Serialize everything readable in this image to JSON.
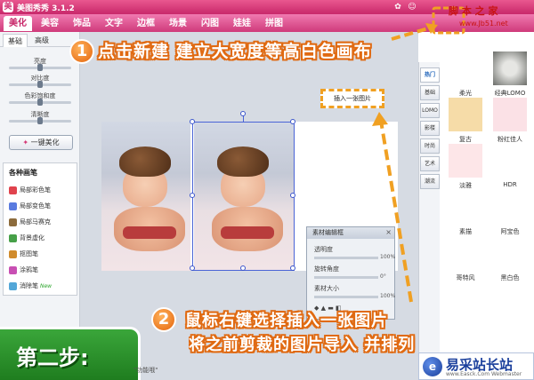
{
  "window": {
    "title": "美图秀秀 3.1.2"
  },
  "menu": {
    "tabs": [
      "美化",
      "美容",
      "饰品",
      "文字",
      "边框",
      "场景",
      "闪图",
      "娃娃",
      "拼图"
    ],
    "active_index": 0
  },
  "left_panel": {
    "subtabs": [
      "基础",
      "高级"
    ],
    "sliders": [
      {
        "label": "亮度",
        "value": 0.5
      },
      {
        "label": "对比度",
        "value": 0.5
      },
      {
        "label": "色彩饱和度",
        "value": 0.5
      },
      {
        "label": "清晰度",
        "value": 0.5
      }
    ],
    "one_click_button": "一键美化",
    "brush_title": "各种画笔",
    "brushes": [
      {
        "label": "局部彩色笔",
        "color": "#e0434d"
      },
      {
        "label": "局部变色笔",
        "color": "#5a7be0"
      },
      {
        "label": "局部马赛克",
        "color": "#8c6b3c"
      },
      {
        "label": "背景虚化",
        "color": "#46a048"
      },
      {
        "label": "抠图笔",
        "color": "#d08b2c"
      },
      {
        "label": "涂鸦笔",
        "color": "#c84fb3"
      },
      {
        "label": "消除笔",
        "color": "#53a7d8",
        "badge": "New"
      }
    ]
  },
  "canvas": {
    "context_label": "插入一张图片"
  },
  "material_panel": {
    "title": "素材编辑框",
    "close": "×",
    "rows": [
      {
        "label": "透明度",
        "value": "100%"
      },
      {
        "label": "旋转角度",
        "value": "0°"
      },
      {
        "label": "素材大小",
        "value": "100%"
      }
    ]
  },
  "right_panel": {
    "categories": [
      "热门",
      "基础",
      "LOMO",
      "影楼",
      "时尚",
      "艺术",
      "潮流"
    ],
    "hot_badge": "热门",
    "effects": [
      {
        "label": "柔光",
        "color": "#f5f7fb"
      },
      {
        "label": "经典LOMO",
        "color": "#8e908c"
      },
      {
        "label": "复古",
        "color": "#f6dca8"
      },
      {
        "label": "粉红佳人",
        "color": "#fbe1e6"
      },
      {
        "label": "淡雅",
        "color": "#fde6e8"
      },
      {
        "label": "HDR",
        "color": "#ffffff"
      },
      {
        "label": "素描",
        "color": "#ffffff"
      },
      {
        "label": "阿宝色",
        "color": "#ffffff"
      },
      {
        "label": "哥特风",
        "color": "#ffffff"
      },
      {
        "label": "黑白色",
        "color": "#ffffff"
      }
    ]
  },
  "annotations": {
    "step1_number": "1",
    "step1_text": "点击新建 建立大宽度等高白色画布",
    "step2_number": "2",
    "step2_line1": "鼠标右键选择插入一张图片",
    "step2_line2": "将之前剪裁的图片导入 并排列",
    "step_label": "第二步:",
    "bottom_hint": "\"功能哦\"",
    "accent_color": "#e06a12"
  },
  "watermarks": {
    "top_text": "脚 本 之 家",
    "top_url": "www.Jb51.net",
    "bottom_logo": "e",
    "bottom_name": "易采站长站",
    "bottom_sub": "www.Easck.Com Webmaster"
  }
}
